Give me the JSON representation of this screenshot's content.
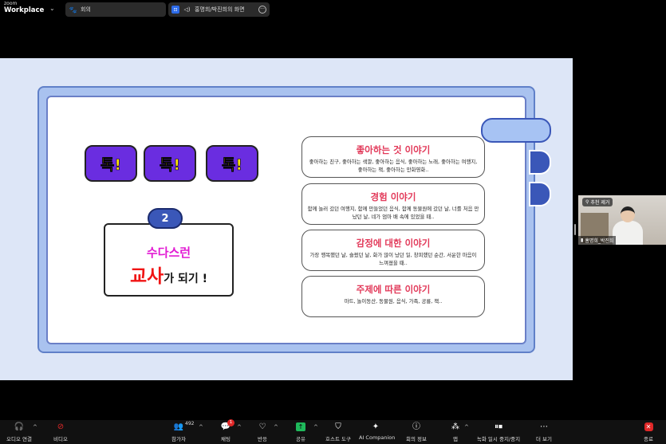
{
  "app": {
    "brand_small": "zoom",
    "brand_large": "Workplace"
  },
  "tabs": [
    {
      "label": "회의",
      "icon": "people-icon"
    },
    {
      "label": "홍명희/박진희의 화면",
      "icon": "screen-share-icon"
    }
  ],
  "slide": {
    "tok_buttons": [
      "톡!",
      "톡!",
      "톡!"
    ],
    "number": "2",
    "title_line1": "수다스런",
    "title_big": "교사",
    "title_rest": "가 되기 !",
    "topics": [
      {
        "title": "좋아하는 것 이야기",
        "desc": "좋아하는 친구, 좋아하는 색깔, 좋아하는 음식, 좋아하는 노래, 좋아하는 여행지, 좋아하는 책, 좋아하는 만화영화.."
      },
      {
        "title": "경험 이야기",
        "desc": "함께 놀러 갔던 여행지, 함께 만들었던 음식, 함께 동물원에 갔던 날, 너를 처음 만났던 날, 네가 엄마 배 속에 있었을 때.."
      },
      {
        "title": "감정에 대한 이야기",
        "desc": "가장 행복했던 날, 슬펐던 날, 화가 많이 났던 일, 창피했던 순간, 서운한 마음이 느껴졌을 때.."
      },
      {
        "title": "주제에 따른 이야기",
        "desc": "마트, 놀이동산, 동물원, 음식, 가족, 공룡, 책.."
      }
    ]
  },
  "participant": {
    "spotlight_label": "추천 제거",
    "name": "홍명희_박진희"
  },
  "toolbar": {
    "audio": "오디오 연결",
    "video": "비디오",
    "participants": "참가자",
    "participants_count": "492",
    "chat": "채팅",
    "chat_badge": "1",
    "react": "반응",
    "share": "공유",
    "host_tools": "호스트 도구",
    "ai": "AI Companion",
    "info": "회의 정보",
    "apps": "앱",
    "record": "녹화 일시 중지/중지",
    "more": "더 보기",
    "end": "종료"
  }
}
